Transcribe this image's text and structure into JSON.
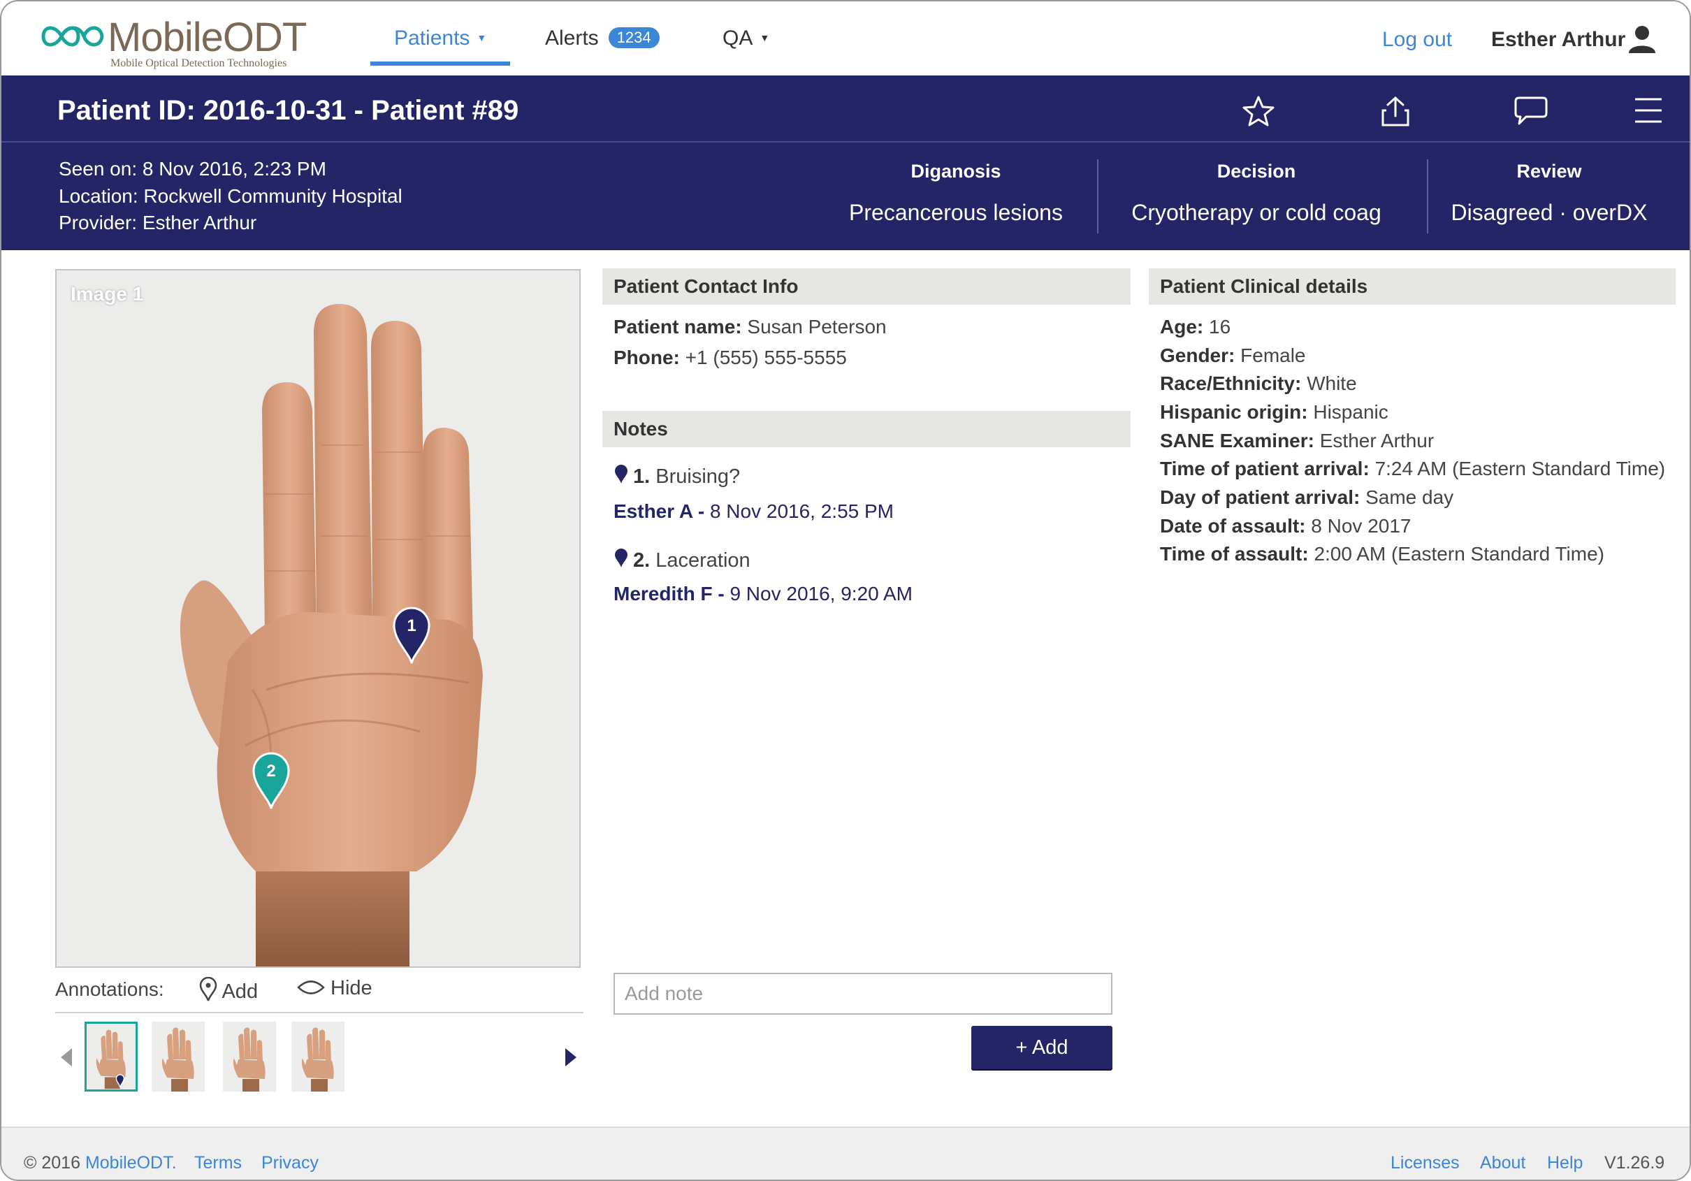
{
  "brand": {
    "name": "MobileODT",
    "tagline": "Mobile Optical Detection Technologies"
  },
  "nav": {
    "patients": "Patients",
    "alerts": "Alerts",
    "alerts_count": "1234",
    "qa": "QA",
    "logout": "Log out",
    "user": "Esther Arthur"
  },
  "patient": {
    "title": "Patient ID: 2016-10-31 - Patient #89",
    "seen_on": "Seen on: 8 Nov 2016, 2:23 PM",
    "location": "Location: Rockwell Community Hospital",
    "provider": "Provider: Esther Arthur"
  },
  "summary": {
    "diagnosis_label": "Diganosis",
    "diagnosis_value": "Precancerous lesions",
    "decision_label": "Decision",
    "decision_value": "Cryotherapy or cold coag",
    "review_label": "Review",
    "review_value": "Disagreed · overDX"
  },
  "image": {
    "label": "Image 1",
    "pins": [
      "1",
      "2"
    ]
  },
  "annotations": {
    "label": "Annotations:",
    "add": "Add",
    "hide": "Hide"
  },
  "contact": {
    "header": "Patient Contact Info",
    "name_label": "Patient name:",
    "name_value": "Susan Peterson",
    "phone_label": "Phone:",
    "phone_value": "+1 (555) 555-5555"
  },
  "notes": {
    "header": "Notes",
    "items": [
      {
        "num": "1.",
        "text": "Bruising?",
        "author": "Esther A -",
        "time": "8 Nov 2016, 2:55 PM"
      },
      {
        "num": "2.",
        "text": "Laceration",
        "author": "Meredith F -",
        "time": "9 Nov 2016, 9:20 AM"
      }
    ],
    "placeholder": "Add note",
    "add_button": "+ Add"
  },
  "clinical": {
    "header": "Patient Clinical details",
    "rows": [
      {
        "label": "Age:",
        "value": "16"
      },
      {
        "label": "Gender:",
        "value": "Female"
      },
      {
        "label": "Race/Ethnicity:",
        "value": "White"
      },
      {
        "label": "Hispanic origin:",
        "value": "Hispanic"
      },
      {
        "label": "SANE Examiner:",
        "value": "Esther Arthur"
      },
      {
        "label": "Time of patient arrival:",
        "value": "7:24 AM (Eastern Standard Time)"
      },
      {
        "label": "Day of patient arrival:",
        "value": "Same day"
      },
      {
        "label": "Date of assault:",
        "value": "8 Nov 2017"
      },
      {
        "label": "Time of assault:",
        "value": "2:00 AM (Eastern Standard Time)"
      }
    ]
  },
  "footer": {
    "copyright": "© 2016",
    "company": "MobileODT.",
    "terms": "Terms",
    "privacy": "Privacy",
    "licenses": "Licenses",
    "about": "About",
    "help": "Help",
    "version": "V1.26.9"
  },
  "colors": {
    "navy": "#232566",
    "link": "#3b86d6",
    "teal": "#1aa59a"
  }
}
